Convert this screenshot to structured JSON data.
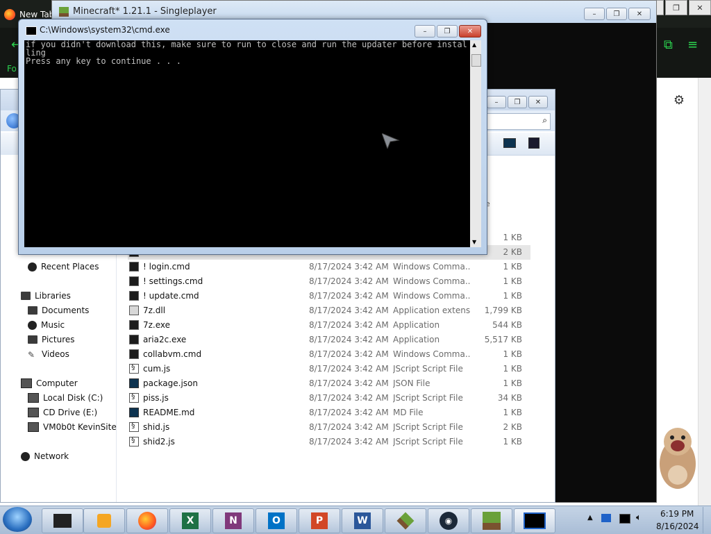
{
  "browser": {
    "tab_label": "New Tab",
    "toolbar_text": "Fo"
  },
  "minecraft_window": {
    "title": "Minecraft* 1.21.1 - Singleplayer"
  },
  "explorer": {
    "nav": {
      "recent_places": "Recent Places",
      "libraries": "Libraries",
      "documents": "Documents",
      "music": "Music",
      "pictures": "Pictures",
      "videos": "Videos",
      "computer": "Computer",
      "local_disk": "Local Disk (C:)",
      "cd_drive": "CD Drive (E:)",
      "network_drive": "VM0b0t KevinSite",
      "network": "Network"
    },
    "partial_column_header": "e",
    "files": [
      {
        "name": "",
        "date": "",
        "type": "",
        "size": "1 KB",
        "icon": "cmd-icon"
      },
      {
        "name": "",
        "date": "",
        "type": "",
        "size": "2 KB",
        "icon": "cmd-icon"
      },
      {
        "name": "! login.cmd",
        "date": "8/17/2024 3:42 AM",
        "type": "Windows Comma...",
        "size": "1 KB",
        "icon": "cmd-icon"
      },
      {
        "name": "! settings.cmd",
        "date": "8/17/2024 3:42 AM",
        "type": "Windows Comma...",
        "size": "1 KB",
        "icon": "cmd-icon"
      },
      {
        "name": "! update.cmd",
        "date": "8/17/2024 3:42 AM",
        "type": "Windows Comma...",
        "size": "1 KB",
        "icon": "cmd-icon"
      },
      {
        "name": "7z.dll",
        "date": "8/17/2024 3:42 AM",
        "type": "Application extens...",
        "size": "1,799 KB",
        "icon": "dll-icon"
      },
      {
        "name": "7z.exe",
        "date": "8/17/2024 3:42 AM",
        "type": "Application",
        "size": "544 KB",
        "icon": "exe-icon"
      },
      {
        "name": "aria2c.exe",
        "date": "8/17/2024 3:42 AM",
        "type": "Application",
        "size": "5,517 KB",
        "icon": "exe-icon"
      },
      {
        "name": "collabvm.cmd",
        "date": "8/17/2024 3:42 AM",
        "type": "Windows Comma...",
        "size": "1 KB",
        "icon": "cmd-icon"
      },
      {
        "name": "cum.js",
        "date": "8/17/2024 3:42 AM",
        "type": "JScript Script File",
        "size": "1 KB",
        "icon": "js-icon"
      },
      {
        "name": "package.json",
        "date": "8/17/2024 3:42 AM",
        "type": "JSON File",
        "size": "1 KB",
        "icon": "json-icon"
      },
      {
        "name": "piss.js",
        "date": "8/17/2024 3:42 AM",
        "type": "JScript Script File",
        "size": "34 KB",
        "icon": "js-icon"
      },
      {
        "name": "README.md",
        "date": "8/17/2024 3:42 AM",
        "type": "MD File",
        "size": "1 KB",
        "icon": "md-icon"
      },
      {
        "name": "shid.js",
        "date": "8/17/2024 3:42 AM",
        "type": "JScript Script File",
        "size": "2 KB",
        "icon": "js-icon"
      },
      {
        "name": "shid2.js",
        "date": "8/17/2024 3:42 AM",
        "type": "JScript Script File",
        "size": "1 KB",
        "icon": "js-icon"
      }
    ]
  },
  "cmd_window": {
    "title": "C:\\Windows\\system32\\cmd.exe",
    "line1": "if you didn't download this, make sure to run to close and run the updater before installing",
    "line2": "Press any key to continue . . ."
  },
  "taskbar": {
    "clock_time": "6:19 PM",
    "clock_date": "8/16/2024",
    "apps": [
      "explorer-icon",
      "media-player-icon",
      "firefox-icon",
      "excel-icon",
      "onenote-icon",
      "outlook-icon",
      "powerpoint-icon",
      "word-icon",
      "minecraft-icon",
      "steam-icon",
      "minecraft-launcher-icon",
      "cmd-icon"
    ]
  }
}
